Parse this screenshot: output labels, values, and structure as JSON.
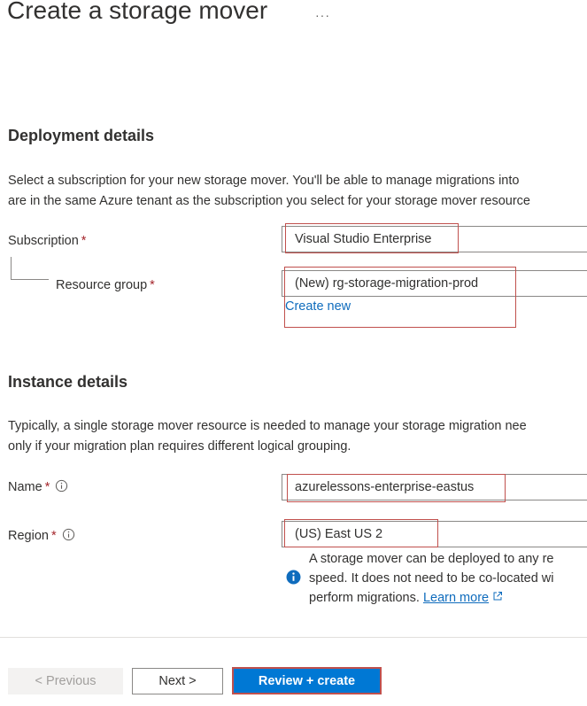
{
  "page": {
    "title": "Create a storage mover",
    "more_actions": "···"
  },
  "deployment": {
    "title": "Deployment details",
    "description_line1": "Select a subscription for your new storage mover. You'll be able to manage migrations into",
    "description_line2": "are in the same Azure tenant as the subscription you select for your storage mover resource",
    "subscription": {
      "label": "Subscription",
      "required_mark": "*",
      "value": "Visual Studio Enterprise"
    },
    "resource_group": {
      "label": "Resource group",
      "required_mark": "*",
      "value": "(New) rg-storage-migration-prod",
      "create_new_link": "Create new"
    }
  },
  "instance": {
    "title": "Instance details",
    "description_line1": "Typically, a single storage mover resource is needed to manage your storage migration nee",
    "description_line2": "only if your migration plan requires different logical grouping.",
    "name": {
      "label": "Name",
      "required_mark": "*",
      "value": "azurelessons-enterprise-eastus"
    },
    "region": {
      "label": "Region",
      "required_mark": "*",
      "value": "(US) East US 2",
      "info_line1": "A storage mover can be deployed to any re",
      "info_line2": "speed. It does not need to be co-located wi",
      "info_line3_prefix": "perform migrations.",
      "learn_more": "Learn more"
    }
  },
  "footer": {
    "previous_label": "< Previous",
    "next_label": "Next >",
    "review_create_label": "Review + create"
  },
  "colors": {
    "accent": "#0078d4",
    "link": "#0f6cbd",
    "required": "#a4262c",
    "highlight": "#c0504d"
  },
  "icons": [
    "more-actions-icon",
    "info-icon",
    "external-link-icon"
  ]
}
